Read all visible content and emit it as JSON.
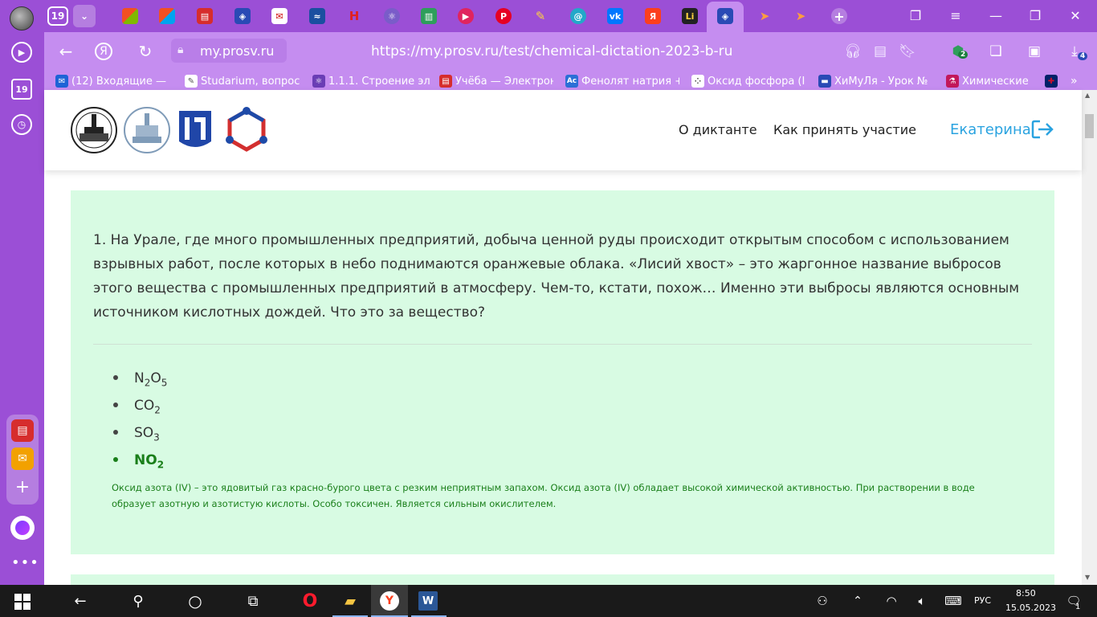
{
  "browser": {
    "tab_counter": "19",
    "url_domain": "my.prosv.ru",
    "url_full": "https://my.prosv.ru/test/chemical-dictation-2023-b-ru",
    "extension_badge": "2",
    "downloads_badge": "4",
    "sidepanel_counter": "19"
  },
  "bookmarks": [
    {
      "icon": "mail-icon",
      "label": "(12) Входящие — ",
      "color": "#1e63d6"
    },
    {
      "icon": "studarium-icon",
      "label": "Studarium, вопрос",
      "color": "#777"
    },
    {
      "icon": "molecule-icon",
      "label": "1.1.1. Строение эл",
      "color": "#6a3db5"
    },
    {
      "icon": "document-icon",
      "label": "Учёба — Электрон",
      "color": "#d62d2d"
    },
    {
      "icon": "ac-icon",
      "label": "Фенолят натрия +",
      "color": "#2b6fd6"
    },
    {
      "icon": "dots-icon",
      "label": "Оксид фосфора (I",
      "color": "#ffffff"
    },
    {
      "icon": "site-icon",
      "label": "ХиМуЛя - Урок №",
      "color": "#2a4ab5"
    },
    {
      "icon": "flask-icon",
      "label": "Химические",
      "color": "#c2185b"
    }
  ],
  "site": {
    "nav": [
      "О диктанте",
      "Как принять участие"
    ],
    "user_name": "Екатерина"
  },
  "question": {
    "text": "1. На Урале, где много промышленных предприятий, добыча ценной руды происходит открытым способом с использованием взрывных работ, после которых в небо поднимаются оранжевые облака. «Лисий хвост» – это жаргонное название выбросов этого вещества с промышленных предприятий в атмосферу. Чем-то, кстати, похож… Именно эти выбросы являются основным источником кислотных дождей. Что это за вещество?",
    "answers": [
      {
        "parts": [
          "N",
          "2",
          "O",
          "5"
        ],
        "correct": false
      },
      {
        "parts": [
          "CO",
          "2"
        ],
        "correct": false
      },
      {
        "parts": [
          "SO",
          "3"
        ],
        "correct": false
      },
      {
        "parts": [
          "NO",
          "2"
        ],
        "correct": true
      }
    ],
    "explanation": "Оксид азота (IV) – это ядовитый газ красно-бурого цвета с резким неприятным запахом. Оксид азота (IV) обладает высокой химической активностью. При растворении в воде образует азотную и азотистую кислоты. Особо токсичен. Является сильным окислителем."
  },
  "taskbar": {
    "language": "РУС",
    "time": "8:50",
    "date": "15.05.2023",
    "notifications": "1"
  },
  "colors": {
    "browser_chrome": "#9b4fd6",
    "address_bar": "#c58df0",
    "card_bg": "#d8fbe3",
    "correct": "#1a7f1a",
    "accent_link": "#2aa3e0"
  }
}
